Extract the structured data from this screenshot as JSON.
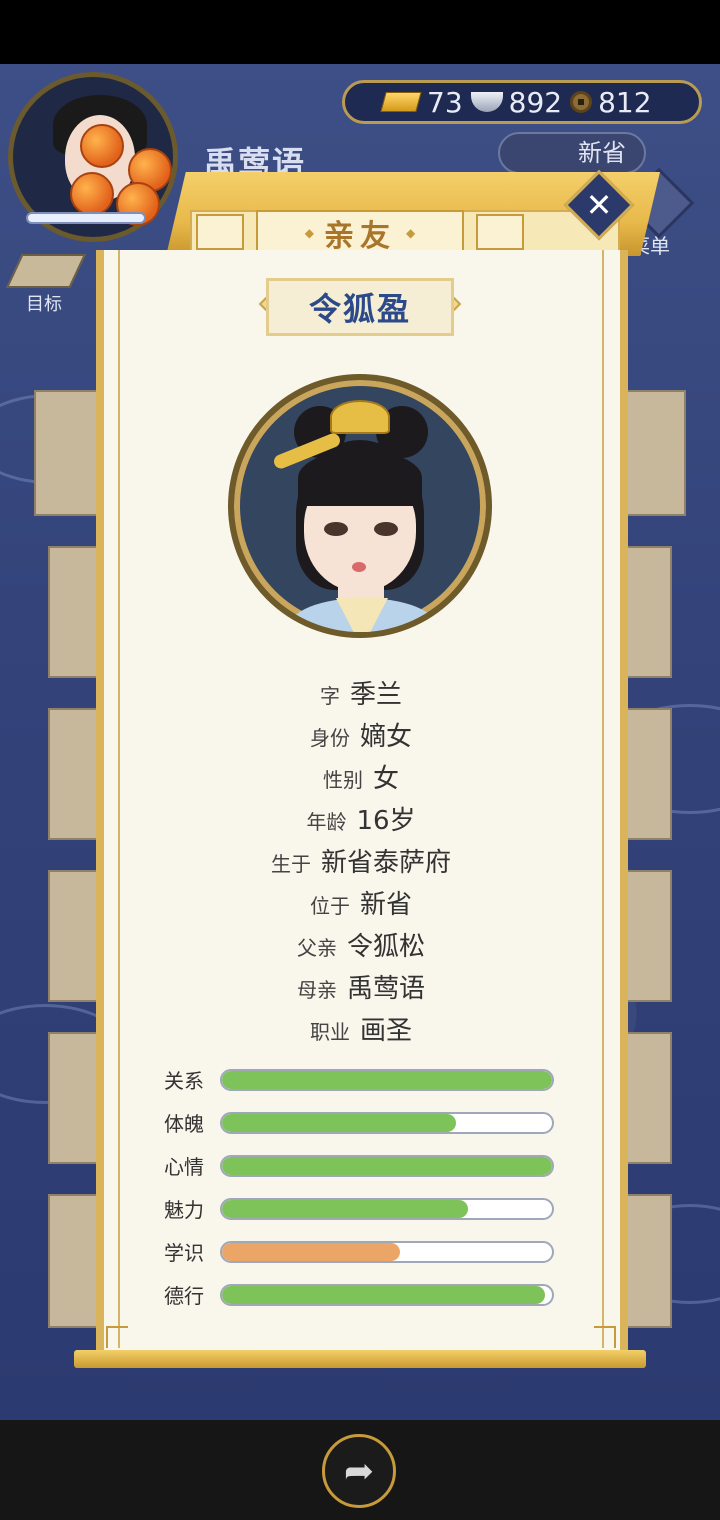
{
  "player": {
    "name": "禹莺语"
  },
  "currency": {
    "gold": "73",
    "silver": "892",
    "coins": "812"
  },
  "location": {
    "label": "新省"
  },
  "hud": {
    "goal_label": "目标",
    "menu_label": "菜单"
  },
  "modal": {
    "title": "亲友",
    "character_name": "令狐盈",
    "info": [
      {
        "key": "字",
        "value": "季兰"
      },
      {
        "key": "身份",
        "value": "嫡女"
      },
      {
        "key": "性别",
        "value": "女"
      },
      {
        "key": "年龄",
        "value": "16岁"
      },
      {
        "key": "生于",
        "value": "新省泰萨府"
      },
      {
        "key": "位于",
        "value": "新省"
      },
      {
        "key": "父亲",
        "value": "令狐松"
      },
      {
        "key": "母亲",
        "value": "禹莺语"
      },
      {
        "key": "职业",
        "value": "画圣"
      }
    ],
    "stats": [
      {
        "label": "关系",
        "level": 1.0,
        "color": "#7dc35a"
      },
      {
        "label": "体魄",
        "level": 0.71,
        "color": "#7dc35a"
      },
      {
        "label": "心情",
        "level": 1.0,
        "color": "#7dc35a"
      },
      {
        "label": "魅力",
        "level": 0.745,
        "color": "#7dc35a"
      },
      {
        "label": "学识",
        "level": 0.54,
        "color": "#eba566"
      },
      {
        "label": "德行",
        "level": 0.98,
        "color": "#7dc35a"
      }
    ]
  },
  "icons": [
    "gold-ingot-icon",
    "silver-ingot-icon",
    "copper-coin-icon",
    "close-icon",
    "share-icon",
    "goal-icon",
    "menu-icon"
  ]
}
